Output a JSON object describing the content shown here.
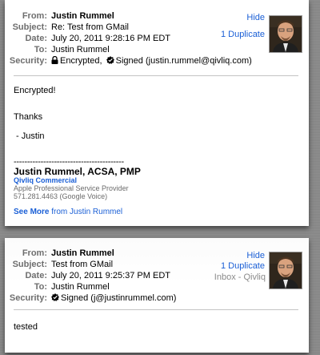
{
  "message1": {
    "labels": {
      "from": "From:",
      "subject": "Subject:",
      "date": "Date:",
      "to": "To:",
      "security": "Security:"
    },
    "from": "Justin Rummel",
    "subject": "Re: Test from GMail",
    "date": "July 20, 2011 9:28:16 PM EDT",
    "to": "Justin Rummel",
    "security_encrypted": "Encrypted,",
    "security_signed": "Signed (justin.rummel@qivliq.com)",
    "hide_label": "Hide",
    "duplicate_label": "1 Duplicate",
    "duplicate_count": "1",
    "body_lines": [
      "Encrypted!",
      "Thanks",
      " - Justin"
    ],
    "signature": {
      "separator": "-----------------------------------------",
      "name": "Justin Rummel, ACSA, PMP",
      "company": "Qivliq Commercial",
      "role": "Apple Professional Service Provider",
      "phone": "571.281.4463 (Google Voice)"
    },
    "see_more_label": "See More",
    "see_more_from": "from Justin Rummel"
  },
  "message2": {
    "labels": {
      "from": "From:",
      "subject": "Subject:",
      "date": "Date:",
      "to": "To:",
      "security": "Security:"
    },
    "from": "Justin Rummel",
    "subject": "Test from GMail",
    "date": "July 20, 2011 9:25:37 PM EDT",
    "to": "Justin Rummel",
    "security_signed": "Signed (j@justinrummel.com)",
    "hide_label": "Hide",
    "duplicate_label": "1 Duplicate",
    "mailbox": "Inbox - Qivliq",
    "body_lines": [
      "tested"
    ]
  },
  "icons": [
    "lock-icon",
    "signed-seal-icon",
    "folder-icon",
    "avatar-photo"
  ],
  "colors": {
    "link": "#1a5fd6",
    "label": "#6e6e6e",
    "divider": "#c4c4c4"
  }
}
